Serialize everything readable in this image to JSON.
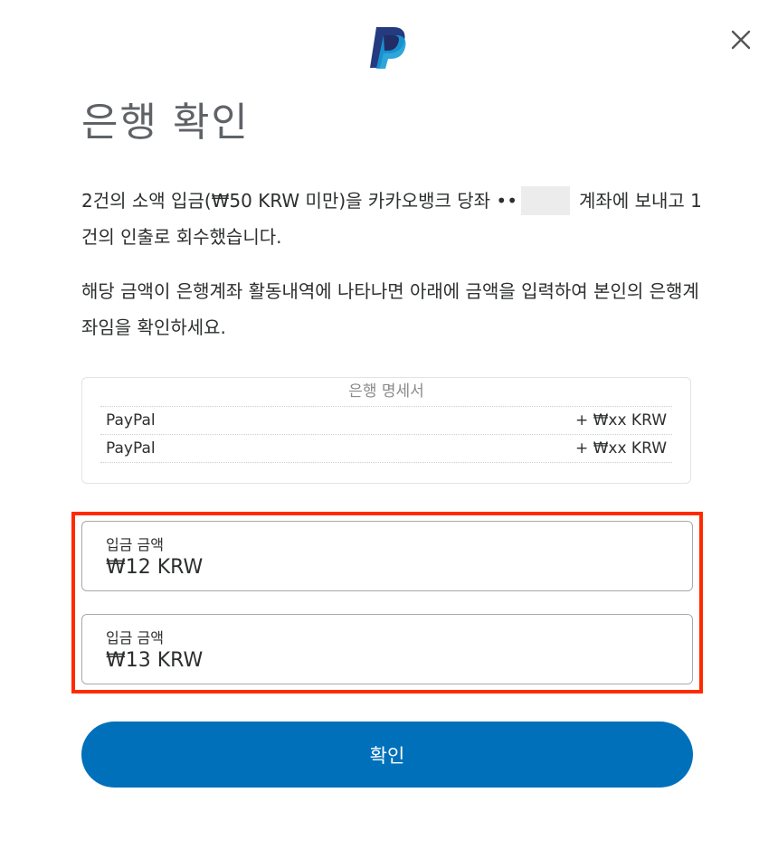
{
  "header": {
    "logo_icon": "paypal-logo-icon",
    "close_icon": "close-icon"
  },
  "title": "은행 확인",
  "paragraph1": {
    "before_mask": "2건의 소액 입금(₩50 KRW 미만)을 카카오뱅크 당좌 ••",
    "after_mask": "계좌에 보내고 1건의 인출로 회수했습니다."
  },
  "paragraph2": "해당 금액이 은행계좌 활동내역에 나타나면 아래에 금액을 입력하여 본인의 은행계좌임을 확인하세요.",
  "statement": {
    "title": "은행 명세서",
    "rows": [
      {
        "name": "PayPal",
        "amount": "+ ₩xx KRW"
      },
      {
        "name": "PayPal",
        "amount": "+ ₩xx KRW"
      }
    ]
  },
  "fields": [
    {
      "label": "입금 금액",
      "value": "₩12 KRW"
    },
    {
      "label": "입금 금액",
      "value": "₩13 KRW"
    }
  ],
  "confirm_label": "확인",
  "colors": {
    "primary": "#0070ba",
    "highlight": "#ff2a00",
    "paypal_dark": "#253b80",
    "paypal_light": "#179bd7"
  }
}
